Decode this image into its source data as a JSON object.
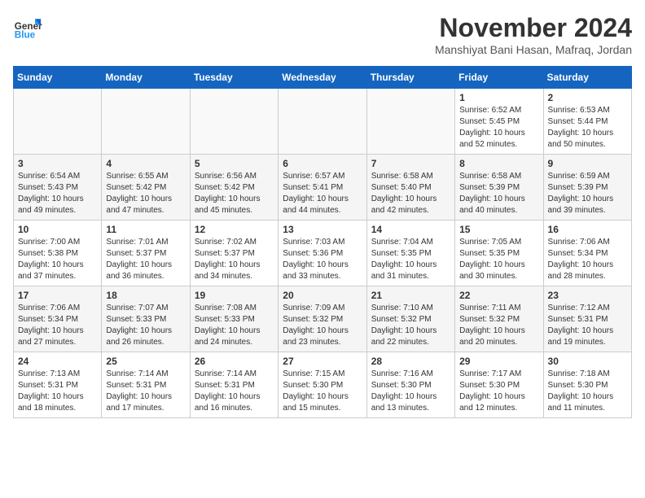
{
  "logo": {
    "line1": "General",
    "line2": "Blue"
  },
  "title": "November 2024",
  "location": "Manshiyat Bani Hasan, Mafraq, Jordan",
  "weekdays": [
    "Sunday",
    "Monday",
    "Tuesday",
    "Wednesday",
    "Thursday",
    "Friday",
    "Saturday"
  ],
  "weeks": [
    [
      {
        "day": "",
        "info": ""
      },
      {
        "day": "",
        "info": ""
      },
      {
        "day": "",
        "info": ""
      },
      {
        "day": "",
        "info": ""
      },
      {
        "day": "",
        "info": ""
      },
      {
        "day": "1",
        "info": "Sunrise: 6:52 AM\nSunset: 5:45 PM\nDaylight: 10 hours\nand 52 minutes."
      },
      {
        "day": "2",
        "info": "Sunrise: 6:53 AM\nSunset: 5:44 PM\nDaylight: 10 hours\nand 50 minutes."
      }
    ],
    [
      {
        "day": "3",
        "info": "Sunrise: 6:54 AM\nSunset: 5:43 PM\nDaylight: 10 hours\nand 49 minutes."
      },
      {
        "day": "4",
        "info": "Sunrise: 6:55 AM\nSunset: 5:42 PM\nDaylight: 10 hours\nand 47 minutes."
      },
      {
        "day": "5",
        "info": "Sunrise: 6:56 AM\nSunset: 5:42 PM\nDaylight: 10 hours\nand 45 minutes."
      },
      {
        "day": "6",
        "info": "Sunrise: 6:57 AM\nSunset: 5:41 PM\nDaylight: 10 hours\nand 44 minutes."
      },
      {
        "day": "7",
        "info": "Sunrise: 6:58 AM\nSunset: 5:40 PM\nDaylight: 10 hours\nand 42 minutes."
      },
      {
        "day": "8",
        "info": "Sunrise: 6:58 AM\nSunset: 5:39 PM\nDaylight: 10 hours\nand 40 minutes."
      },
      {
        "day": "9",
        "info": "Sunrise: 6:59 AM\nSunset: 5:39 PM\nDaylight: 10 hours\nand 39 minutes."
      }
    ],
    [
      {
        "day": "10",
        "info": "Sunrise: 7:00 AM\nSunset: 5:38 PM\nDaylight: 10 hours\nand 37 minutes."
      },
      {
        "day": "11",
        "info": "Sunrise: 7:01 AM\nSunset: 5:37 PM\nDaylight: 10 hours\nand 36 minutes."
      },
      {
        "day": "12",
        "info": "Sunrise: 7:02 AM\nSunset: 5:37 PM\nDaylight: 10 hours\nand 34 minutes."
      },
      {
        "day": "13",
        "info": "Sunrise: 7:03 AM\nSunset: 5:36 PM\nDaylight: 10 hours\nand 33 minutes."
      },
      {
        "day": "14",
        "info": "Sunrise: 7:04 AM\nSunset: 5:35 PM\nDaylight: 10 hours\nand 31 minutes."
      },
      {
        "day": "15",
        "info": "Sunrise: 7:05 AM\nSunset: 5:35 PM\nDaylight: 10 hours\nand 30 minutes."
      },
      {
        "day": "16",
        "info": "Sunrise: 7:06 AM\nSunset: 5:34 PM\nDaylight: 10 hours\nand 28 minutes."
      }
    ],
    [
      {
        "day": "17",
        "info": "Sunrise: 7:06 AM\nSunset: 5:34 PM\nDaylight: 10 hours\nand 27 minutes."
      },
      {
        "day": "18",
        "info": "Sunrise: 7:07 AM\nSunset: 5:33 PM\nDaylight: 10 hours\nand 26 minutes."
      },
      {
        "day": "19",
        "info": "Sunrise: 7:08 AM\nSunset: 5:33 PM\nDaylight: 10 hours\nand 24 minutes."
      },
      {
        "day": "20",
        "info": "Sunrise: 7:09 AM\nSunset: 5:32 PM\nDaylight: 10 hours\nand 23 minutes."
      },
      {
        "day": "21",
        "info": "Sunrise: 7:10 AM\nSunset: 5:32 PM\nDaylight: 10 hours\nand 22 minutes."
      },
      {
        "day": "22",
        "info": "Sunrise: 7:11 AM\nSunset: 5:32 PM\nDaylight: 10 hours\nand 20 minutes."
      },
      {
        "day": "23",
        "info": "Sunrise: 7:12 AM\nSunset: 5:31 PM\nDaylight: 10 hours\nand 19 minutes."
      }
    ],
    [
      {
        "day": "24",
        "info": "Sunrise: 7:13 AM\nSunset: 5:31 PM\nDaylight: 10 hours\nand 18 minutes."
      },
      {
        "day": "25",
        "info": "Sunrise: 7:14 AM\nSunset: 5:31 PM\nDaylight: 10 hours\nand 17 minutes."
      },
      {
        "day": "26",
        "info": "Sunrise: 7:14 AM\nSunset: 5:31 PM\nDaylight: 10 hours\nand 16 minutes."
      },
      {
        "day": "27",
        "info": "Sunrise: 7:15 AM\nSunset: 5:30 PM\nDaylight: 10 hours\nand 15 minutes."
      },
      {
        "day": "28",
        "info": "Sunrise: 7:16 AM\nSunset: 5:30 PM\nDaylight: 10 hours\nand 13 minutes."
      },
      {
        "day": "29",
        "info": "Sunrise: 7:17 AM\nSunset: 5:30 PM\nDaylight: 10 hours\nand 12 minutes."
      },
      {
        "day": "30",
        "info": "Sunrise: 7:18 AM\nSunset: 5:30 PM\nDaylight: 10 hours\nand 11 minutes."
      }
    ]
  ]
}
